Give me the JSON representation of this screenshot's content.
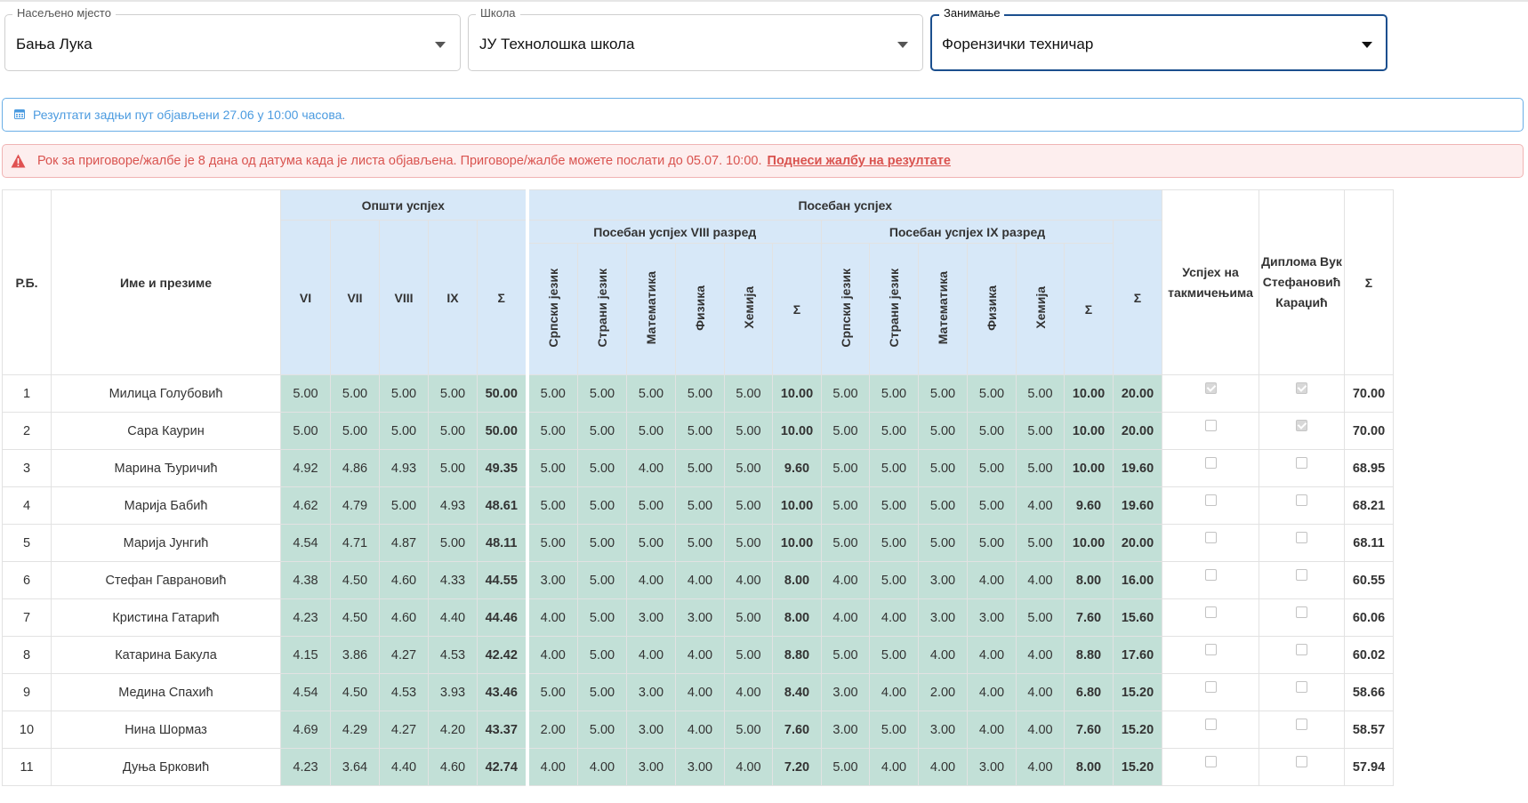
{
  "filters": {
    "place": {
      "label": "Насељено мјесто",
      "value": "Бања Лука"
    },
    "school": {
      "label": "Школа",
      "value": "ЈУ Технолошка школа"
    },
    "occupation": {
      "label": "Занимање",
      "value": "Форензички техничар"
    }
  },
  "info": {
    "text": "Резултати задњи пут објављени 27.06 у 10:00 часова."
  },
  "warning": {
    "text": "Рок за приговоре/жалбе је 8 дана од датума када је листа објављена. Приговоре/жалбе можете послати до 05.07. 10:00.",
    "link": "Поднеси жалбу на резултате"
  },
  "table": {
    "headers": {
      "rb": "Р.Б.",
      "name": "Име и презиме",
      "general": "Општи успјех",
      "special": "Посебан успјех",
      "special8": "Посебан успјех VIII разред",
      "special9": "Посебан успјех IX разред",
      "competitions": "Успјех на такмичењима",
      "diploma": "Диплома Вук Стефановић Караџић",
      "total": "Σ",
      "general_cols": [
        "VI",
        "VII",
        "VIII",
        "IX",
        "Σ"
      ],
      "subject_cols": [
        "Српски језик",
        "Страни језик",
        "Математика",
        "Физика",
        "Хемија",
        "Σ"
      ],
      "special_sum": "Σ"
    },
    "rows": [
      {
        "rb": "1",
        "name": "Милица Голубовић",
        "g": [
          "5.00",
          "5.00",
          "5.00",
          "5.00",
          "50.00"
        ],
        "s8": [
          "5.00",
          "5.00",
          "5.00",
          "5.00",
          "5.00",
          "10.00"
        ],
        "s9": [
          "5.00",
          "5.00",
          "5.00",
          "5.00",
          "5.00",
          "10.00"
        ],
        "ss": "20.00",
        "comp": true,
        "dipl": true,
        "total": "70.00"
      },
      {
        "rb": "2",
        "name": "Сара Каурин",
        "g": [
          "5.00",
          "5.00",
          "5.00",
          "5.00",
          "50.00"
        ],
        "s8": [
          "5.00",
          "5.00",
          "5.00",
          "5.00",
          "5.00",
          "10.00"
        ],
        "s9": [
          "5.00",
          "5.00",
          "5.00",
          "5.00",
          "5.00",
          "10.00"
        ],
        "ss": "20.00",
        "comp": false,
        "dipl": true,
        "total": "70.00"
      },
      {
        "rb": "3",
        "name": "Марина Ђуричић",
        "g": [
          "4.92",
          "4.86",
          "4.93",
          "5.00",
          "49.35"
        ],
        "s8": [
          "5.00",
          "5.00",
          "4.00",
          "5.00",
          "5.00",
          "9.60"
        ],
        "s9": [
          "5.00",
          "5.00",
          "5.00",
          "5.00",
          "5.00",
          "10.00"
        ],
        "ss": "19.60",
        "comp": false,
        "dipl": false,
        "total": "68.95"
      },
      {
        "rb": "4",
        "name": "Марија Бабић",
        "g": [
          "4.62",
          "4.79",
          "5.00",
          "4.93",
          "48.61"
        ],
        "s8": [
          "5.00",
          "5.00",
          "5.00",
          "5.00",
          "5.00",
          "10.00"
        ],
        "s9": [
          "5.00",
          "5.00",
          "5.00",
          "5.00",
          "4.00",
          "9.60"
        ],
        "ss": "19.60",
        "comp": false,
        "dipl": false,
        "total": "68.21"
      },
      {
        "rb": "5",
        "name": "Марија Јунгић",
        "g": [
          "4.54",
          "4.71",
          "4.87",
          "5.00",
          "48.11"
        ],
        "s8": [
          "5.00",
          "5.00",
          "5.00",
          "5.00",
          "5.00",
          "10.00"
        ],
        "s9": [
          "5.00",
          "5.00",
          "5.00",
          "5.00",
          "5.00",
          "10.00"
        ],
        "ss": "20.00",
        "comp": false,
        "dipl": false,
        "total": "68.11"
      },
      {
        "rb": "6",
        "name": "Стефан Гаврановић",
        "g": [
          "4.38",
          "4.50",
          "4.60",
          "4.33",
          "44.55"
        ],
        "s8": [
          "3.00",
          "5.00",
          "4.00",
          "4.00",
          "4.00",
          "8.00"
        ],
        "s9": [
          "4.00",
          "5.00",
          "3.00",
          "4.00",
          "4.00",
          "8.00"
        ],
        "ss": "16.00",
        "comp": false,
        "dipl": false,
        "total": "60.55"
      },
      {
        "rb": "7",
        "name": "Кристина Гатарић",
        "g": [
          "4.23",
          "4.50",
          "4.60",
          "4.40",
          "44.46"
        ],
        "s8": [
          "4.00",
          "5.00",
          "3.00",
          "3.00",
          "5.00",
          "8.00"
        ],
        "s9": [
          "4.00",
          "4.00",
          "3.00",
          "3.00",
          "5.00",
          "7.60"
        ],
        "ss": "15.60",
        "comp": false,
        "dipl": false,
        "total": "60.06"
      },
      {
        "rb": "8",
        "name": "Катарина Бакула",
        "g": [
          "4.15",
          "3.86",
          "4.27",
          "4.53",
          "42.42"
        ],
        "s8": [
          "4.00",
          "5.00",
          "4.00",
          "4.00",
          "5.00",
          "8.80"
        ],
        "s9": [
          "5.00",
          "5.00",
          "4.00",
          "4.00",
          "4.00",
          "8.80"
        ],
        "ss": "17.60",
        "comp": false,
        "dipl": false,
        "total": "60.02"
      },
      {
        "rb": "9",
        "name": "Медина Спахић",
        "g": [
          "4.54",
          "4.50",
          "4.53",
          "3.93",
          "43.46"
        ],
        "s8": [
          "5.00",
          "5.00",
          "3.00",
          "4.00",
          "4.00",
          "8.40"
        ],
        "s9": [
          "3.00",
          "4.00",
          "2.00",
          "4.00",
          "4.00",
          "6.80"
        ],
        "ss": "15.20",
        "comp": false,
        "dipl": false,
        "total": "58.66"
      },
      {
        "rb": "10",
        "name": "Нина Шормаз",
        "g": [
          "4.69",
          "4.29",
          "4.27",
          "4.20",
          "43.37"
        ],
        "s8": [
          "2.00",
          "5.00",
          "3.00",
          "4.00",
          "5.00",
          "7.60"
        ],
        "s9": [
          "3.00",
          "5.00",
          "3.00",
          "4.00",
          "4.00",
          "7.60"
        ],
        "ss": "15.20",
        "comp": false,
        "dipl": false,
        "total": "58.57"
      },
      {
        "rb": "11",
        "name": "Дуња Брковић",
        "g": [
          "4.23",
          "3.64",
          "4.40",
          "4.60",
          "42.74"
        ],
        "s8": [
          "4.00",
          "4.00",
          "3.00",
          "3.00",
          "4.00",
          "7.20"
        ],
        "s9": [
          "5.00",
          "4.00",
          "4.00",
          "3.00",
          "4.00",
          "8.00"
        ],
        "ss": "15.20",
        "comp": false,
        "dipl": false,
        "total": "57.94"
      }
    ]
  }
}
